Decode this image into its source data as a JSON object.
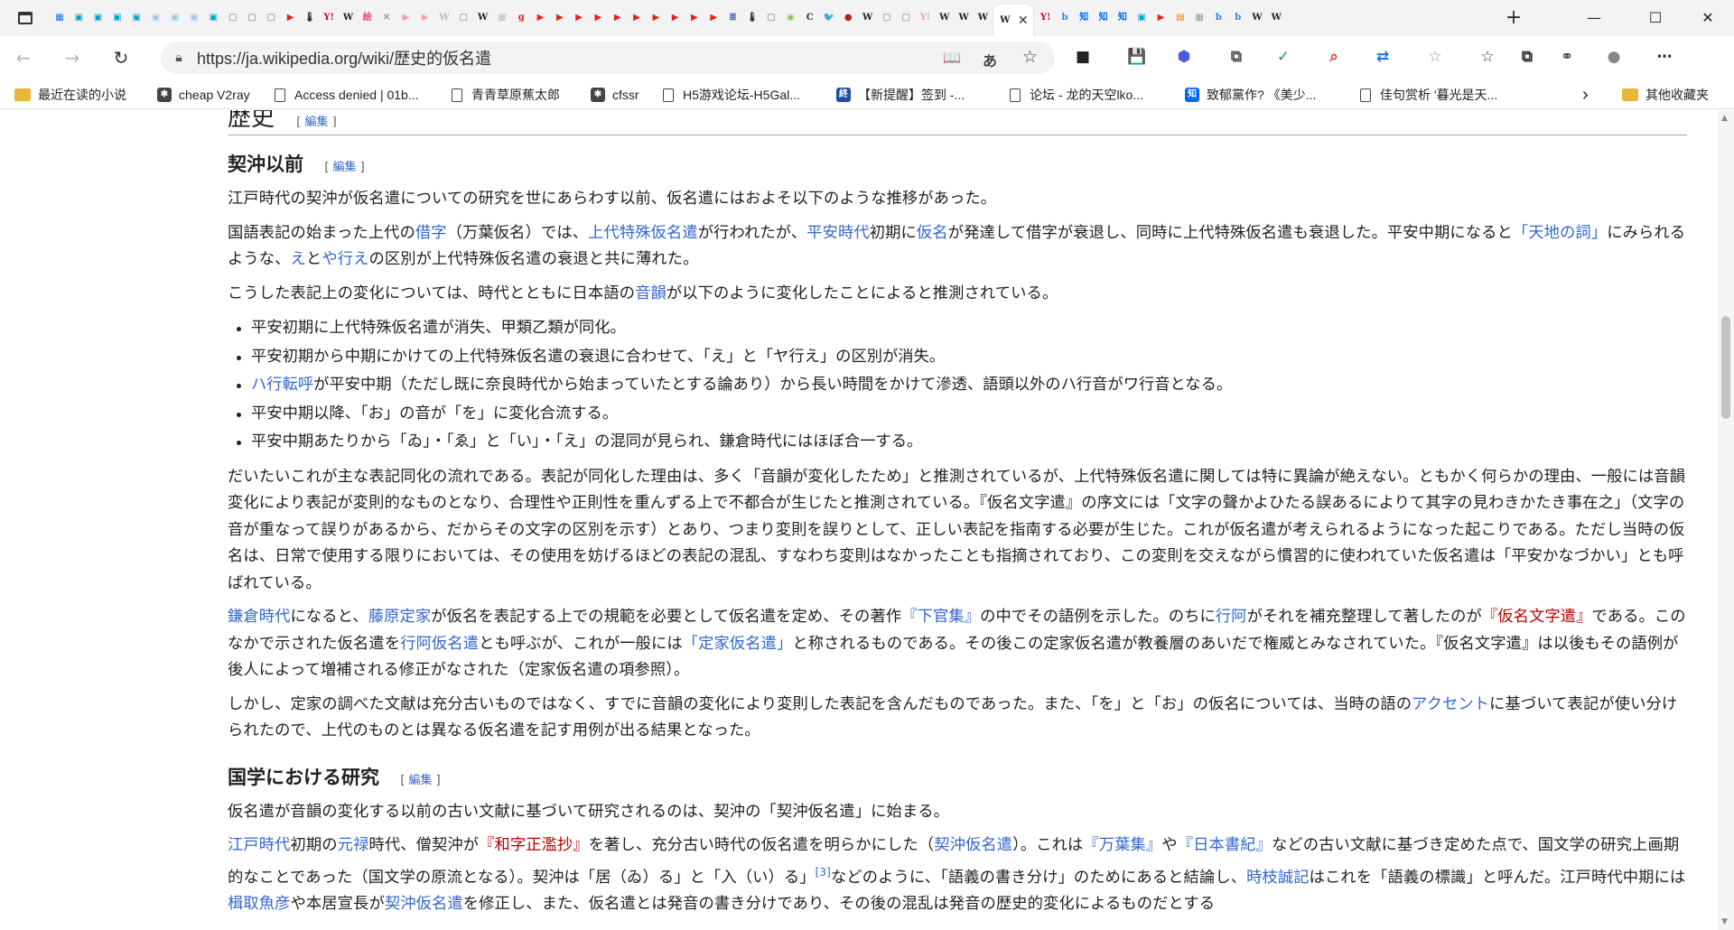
{
  "browser": {
    "tabs": [
      {
        "icon": "grid-icon",
        "color": "#1a73e8",
        "glyph": "▦"
      },
      {
        "icon": "bilibili-icon",
        "color": "#00a1d6",
        "glyph": "▣"
      },
      {
        "icon": "bilibili-icon",
        "color": "#00a1d6",
        "glyph": "▣"
      },
      {
        "icon": "bilibili-icon",
        "color": "#00a1d6",
        "glyph": "▣"
      },
      {
        "icon": "bilibili-icon",
        "color": "#00a1d6",
        "glyph": "▣"
      },
      {
        "icon": "bilibili-icon",
        "color": "#9ec9e0",
        "glyph": "▣"
      },
      {
        "icon": "bilibili-icon",
        "color": "#9ec9e0",
        "glyph": "▣"
      },
      {
        "icon": "bilibili-icon",
        "color": "#9ec9e0",
        "glyph": "▣"
      },
      {
        "icon": "bilibili-icon",
        "color": "#00a1d6",
        "glyph": "▣"
      },
      {
        "icon": "page-icon",
        "color": "#777",
        "glyph": "▢"
      },
      {
        "icon": "page-icon",
        "color": "#777",
        "glyph": "▢"
      },
      {
        "icon": "page-icon",
        "color": "#777",
        "glyph": "▢"
      },
      {
        "icon": "youtube-icon",
        "color": "#e62117",
        "glyph": "▶"
      },
      {
        "icon": "thermometer-icon",
        "color": "#222",
        "glyph": "🌡"
      },
      {
        "icon": "yahoo-icon",
        "color": "#d0021b",
        "glyph": "Y!"
      },
      {
        "icon": "wikipedia-icon",
        "color": "#222",
        "glyph": "W"
      },
      {
        "icon": "red-badge-icon",
        "color": "#e8478b",
        "glyph": "絵"
      },
      {
        "icon": "ghost-icon",
        "color": "#999",
        "glyph": "✕"
      },
      {
        "icon": "youtube-icon",
        "color": "#f0a0a0",
        "glyph": "▶"
      },
      {
        "icon": "youtube-icon",
        "color": "#f0a0a0",
        "glyph": "▶"
      },
      {
        "icon": "wikipedia-icon",
        "color": "#bbb",
        "glyph": "W"
      },
      {
        "icon": "page-icon",
        "color": "#777",
        "glyph": "▢"
      },
      {
        "icon": "wikipedia-icon",
        "color": "#222",
        "glyph": "W"
      },
      {
        "icon": "grid-icon",
        "color": "#bbb",
        "glyph": "▦"
      },
      {
        "icon": "google-icon",
        "color": "#e62117",
        "glyph": "g"
      },
      {
        "icon": "youtube-icon",
        "color": "#e62117",
        "glyph": "▶"
      },
      {
        "icon": "youtube-icon",
        "color": "#e62117",
        "glyph": "▶"
      },
      {
        "icon": "youtube-icon",
        "color": "#e62117",
        "glyph": "▶"
      },
      {
        "icon": "youtube-icon",
        "color": "#e62117",
        "glyph": "▶"
      },
      {
        "icon": "youtube-icon",
        "color": "#e62117",
        "glyph": "▶"
      },
      {
        "icon": "youtube-icon",
        "color": "#e62117",
        "glyph": "▶"
      },
      {
        "icon": "youtube-icon",
        "color": "#e62117",
        "glyph": "▶"
      },
      {
        "icon": "youtube-icon",
        "color": "#e62117",
        "glyph": "▶"
      },
      {
        "icon": "youtube-icon",
        "color": "#e62117",
        "glyph": "▶"
      },
      {
        "icon": "youtube-icon",
        "color": "#e62117",
        "glyph": "▶"
      },
      {
        "icon": "news-icon",
        "color": "#4a6fb5",
        "glyph": "≣"
      },
      {
        "icon": "thermometer-icon",
        "color": "#222",
        "glyph": "🌡"
      },
      {
        "icon": "page-icon",
        "color": "#777",
        "glyph": "▢"
      },
      {
        "icon": "android-icon",
        "color": "#8bc34a",
        "glyph": "◉"
      },
      {
        "icon": "c-icon",
        "color": "#333",
        "glyph": "C"
      },
      {
        "icon": "twitter-icon",
        "color": "#1da1f2",
        "glyph": "🐦"
      },
      {
        "icon": "anime-icon",
        "color": "#b02020",
        "glyph": "●"
      },
      {
        "icon": "wikipedia-icon",
        "color": "#222",
        "glyph": "W"
      },
      {
        "icon": "page-icon",
        "color": "#777",
        "glyph": "▢"
      },
      {
        "icon": "page-icon",
        "color": "#777",
        "glyph": "▢"
      },
      {
        "icon": "yahoo-icon",
        "color": "#f0a0c0",
        "glyph": "Y!"
      },
      {
        "icon": "wikipedia-icon",
        "color": "#222",
        "glyph": "W"
      },
      {
        "icon": "wikipedia-icon",
        "color": "#222",
        "glyph": "W"
      },
      {
        "icon": "wikipedia-icon",
        "color": "#222",
        "glyph": "W"
      },
      {
        "icon": "wikipedia-icon",
        "color": "#222",
        "glyph": "W",
        "active": true
      },
      {
        "icon": "yahoo-icon",
        "color": "#d0021b",
        "glyph": "Y!"
      },
      {
        "icon": "bing-icon",
        "color": "#2f80ed",
        "glyph": "b"
      },
      {
        "icon": "zhihu-icon",
        "color": "#0066ff",
        "glyph": "知"
      },
      {
        "icon": "zhihu-icon",
        "color": "#0066ff",
        "glyph": "知"
      },
      {
        "icon": "zhihu-icon",
        "color": "#0066ff",
        "glyph": "知"
      },
      {
        "icon": "bilibili-icon",
        "color": "#00a1d6",
        "glyph": "▣"
      },
      {
        "icon": "youtube-icon",
        "color": "#e62117",
        "glyph": "▶"
      },
      {
        "icon": "orange-icon",
        "color": "#f57c00",
        "glyph": "▤"
      },
      {
        "icon": "grid-icon",
        "color": "#999",
        "glyph": "▦"
      },
      {
        "icon": "bing-icon",
        "color": "#2f80ed",
        "glyph": "b"
      },
      {
        "icon": "bing-icon",
        "color": "#2f80ed",
        "glyph": "b"
      },
      {
        "icon": "wikipedia-icon",
        "color": "#222",
        "glyph": "W"
      },
      {
        "icon": "wikipedia-icon",
        "color": "#222",
        "glyph": "W"
      }
    ],
    "close_glyph": "✕",
    "newtab_glyph": "+",
    "window": {
      "minimize": "—",
      "maximize": "☐",
      "close": "✕"
    },
    "nav": {
      "back": "←",
      "forward": "→",
      "reload": "↻"
    },
    "url": "https://ja.wikipedia.org/wiki/歴史的仮名遣",
    "omni_icons": {
      "reader": "📖",
      "translate": "あ",
      "favorite": "☆"
    },
    "ext_icons": [
      {
        "name": "extension-dark-icon",
        "color": "#222",
        "glyph": "■"
      },
      {
        "name": "save-icon",
        "color": "#1aa0e8",
        "glyph": "💾"
      },
      {
        "name": "cube-icon",
        "color": "#4e5bd8",
        "glyph": "⬢"
      },
      {
        "name": "puzzle-icon",
        "color": "#555",
        "glyph": "⧉"
      },
      {
        "name": "shield-icon",
        "color": "#1e9e4a",
        "glyph": "✓"
      },
      {
        "name": "search-red-icon",
        "color": "#e53935",
        "glyph": "⌕"
      },
      {
        "name": "translate-icon",
        "color": "#1a73e8",
        "glyph": "⇄"
      },
      {
        "name": "favorites-icon",
        "color": "#999",
        "glyph": "☆"
      },
      {
        "name": "favorites-list-icon",
        "color": "#333",
        "glyph": "☆"
      },
      {
        "name": "collections-icon",
        "color": "#333",
        "glyph": "⧉"
      },
      {
        "name": "link-icon",
        "color": "#333",
        "glyph": "⚭"
      },
      {
        "name": "profile-icon",
        "color": "#888",
        "glyph": "●"
      },
      {
        "name": "more-icon",
        "color": "#333",
        "glyph": "⋯"
      }
    ]
  },
  "bookmarks": [
    {
      "type": "folder",
      "label": "最近在读的小说"
    },
    {
      "type": "site",
      "label": "cheap V2ray",
      "icon": "spider-icon",
      "color": "#444",
      "glyph": "✱"
    },
    {
      "type": "page",
      "label": "Access denied | 01b..."
    },
    {
      "type": "page",
      "label": "青青草原蕉太郎"
    },
    {
      "type": "site",
      "label": "cfssr",
      "icon": "spider-icon",
      "color": "#444",
      "glyph": "✱"
    },
    {
      "type": "page",
      "label": "H5游戏论坛-H5Gal..."
    },
    {
      "type": "site",
      "label": "【新提醒】签到 -...",
      "icon": "blue-kanji-icon",
      "color": "#1e4fa3",
      "glyph": "終"
    },
    {
      "type": "page",
      "label": "论坛 - 龙的天空lko..."
    },
    {
      "type": "site",
      "label": "致郁黨作? 《美少...",
      "icon": "zhihu-icon",
      "color": "#0066ff",
      "glyph": "知"
    },
    {
      "type": "page",
      "label": "佳句赏析 '暮光是天..."
    },
    {
      "type": "chevron",
      "label": "›"
    },
    {
      "type": "folder",
      "label": "其他收藏夹"
    }
  ],
  "article": {
    "section_title": "歴史",
    "edit_label": "編集",
    "sub1_title": "契沖以前",
    "p1": "江戸時代の契沖が仮名遣についての研究を世にあらわす以前、仮名遣にはおよそ以下のような推移があった。",
    "p2": [
      {
        "t": "国語表記の始まった上代の"
      },
      {
        "t": "借字",
        "l": true
      },
      {
        "t": "（万葉仮名）では、"
      },
      {
        "t": "上代特殊仮名遣",
        "l": true
      },
      {
        "t": "が行われたが、"
      },
      {
        "t": "平安時代",
        "l": true
      },
      {
        "t": "初期に"
      },
      {
        "t": "仮名",
        "l": true
      },
      {
        "t": "が発達して借字が衰退し、同時に上代特殊仮名遣も衰退した。平安中期になると"
      },
      {
        "t": "「天地の詞」",
        "l": true
      },
      {
        "t": "にみられるような、"
      },
      {
        "t": "え",
        "l": true
      },
      {
        "t": "と"
      },
      {
        "t": "や行え",
        "l": true
      },
      {
        "t": "の区別が上代特殊仮名遣の衰退と共に薄れた。"
      }
    ],
    "p3": [
      {
        "t": "こうした表記上の変化については、時代とともに日本語の"
      },
      {
        "t": "音韻",
        "l": true
      },
      {
        "t": "が以下のように変化したことによると推測されている。"
      }
    ],
    "bullets": [
      [
        {
          "t": "平安初期に上代特殊仮名遣が消失、甲類乙類が同化。"
        }
      ],
      [
        {
          "t": "平安初期から中期にかけての上代特殊仮名遣の衰退に合わせて、「え」と「ヤ行え」の区別が消失。"
        }
      ],
      [
        {
          "t": "ハ行転呼",
          "l": true
        },
        {
          "t": "が平安中期（ただし既に奈良時代から始まっていたとする論あり）から長い時間をかけて滲透、語頭以外のハ行音がワ行音となる。"
        }
      ],
      [
        {
          "t": "平安中期以降、「お」の音が「を」に変化合流する。"
        }
      ],
      [
        {
          "t": "平安中期あたりから「ゐ」・「ゑ」と「い」・「え」の混同が見られ、鎌倉時代にはほぼ合一する。"
        }
      ]
    ],
    "p4": "だいたいこれが主な表記同化の流れである。表記が同化した理由は、多く「音韻が変化したため」と推測されているが、上代特殊仮名遣に関しては特に異論が絶えない。ともかく何らかの理由、一般には音韻変化により表記が変則的なものとなり、合理性や正則性を重んずる上で不都合が生じたと推測されている。『仮名文字遣』の序文には「文字の聲かよひたる誤あるによりて其字の見わきかたき事在之」（文字の音が重なって誤りがあるから、だからその文字の区別を示す）とあり、つまり変則を誤りとして、正しい表記を指南する必要が生じた。これが仮名遣が考えられるようになった起こりである。ただし当時の仮名は、日常で使用する限りにおいては、その使用を妨げるほどの表記の混乱、すなわち変則はなかったことも指摘されており、この変則を交えながら慣習的に使われていた仮名遣は「平安かなづかい」とも呼ばれている。",
    "p5": [
      {
        "t": "鎌倉時代",
        "l": true
      },
      {
        "t": "になると、"
      },
      {
        "t": "藤原定家",
        "l": true
      },
      {
        "t": "が仮名を表記する上での規範を必要として仮名遣を定め、その著作"
      },
      {
        "t": "『下官集』",
        "l": true
      },
      {
        "t": "の中でその語例を示した。のちに"
      },
      {
        "t": "行阿",
        "l": true
      },
      {
        "t": "がそれを補充整理して著したのが"
      },
      {
        "t": "『仮名文字遣』",
        "r": true
      },
      {
        "t": "である。このなかで示された仮名遣を"
      },
      {
        "t": "行阿仮名遣",
        "l": true
      },
      {
        "t": "とも呼ぶが、これが一般には"
      },
      {
        "t": "「定家仮名遣」",
        "l": true
      },
      {
        "t": "と称されるものである。その後この定家仮名遣が教養層のあいだで権威とみなされていた。『仮名文字遣』は以後もその語例が後人によって増補される修正がなされた（定家仮名遣の項参照）。"
      }
    ],
    "p6": [
      {
        "t": "しかし、定家の調べた文献は充分古いものではなく、すでに音韻の変化により変則した表記を含んだものであった。また、「を」と「お」の仮名については、当時の語の"
      },
      {
        "t": "アクセント",
        "l": true
      },
      {
        "t": "に基づいて表記が使い分けられたので、上代のものとは異なる仮名遣を記す用例が出る結果となった。"
      }
    ],
    "sub2_title": "国学における研究",
    "p7": "仮名遣が音韻の変化する以前の古い文献に基づいて研究されるのは、契沖の「契沖仮名遣」に始まる。",
    "p8": [
      {
        "t": "江戸時代",
        "l": true
      },
      {
        "t": "初期の"
      },
      {
        "t": "元禄",
        "l": true
      },
      {
        "t": "時代、僧契沖が"
      },
      {
        "t": "『和字正濫抄』",
        "r": true
      },
      {
        "t": "を著し、充分古い時代の仮名遣を明らかにした（"
      },
      {
        "t": "契沖仮名遣",
        "l": true
      },
      {
        "t": "）。これは"
      },
      {
        "t": "『万葉集』",
        "l": true
      },
      {
        "t": "や"
      },
      {
        "t": "『日本書紀』",
        "l": true
      },
      {
        "t": "などの古い文献に基づき定めた点で、国文学の研究上画期的なことであった（国文学の原流となる）。契沖は「居（ゐ）る」と「入（い）る」"
      },
      {
        "t": "[3]",
        "s": true
      },
      {
        "t": "などのように、「語義の書き分け」のためにあると結論し、"
      },
      {
        "t": "時枝誠記",
        "l": true
      },
      {
        "t": "はこれを「語義の標識」と呼んだ。江戸時代中期には"
      },
      {
        "t": "楫取魚彦",
        "l": true
      },
      {
        "t": "や本居宣長が"
      },
      {
        "t": "契沖仮名遣",
        "l": true
      },
      {
        "t": "を修正し、また、仮名遣とは発音の書き分けであり、その後の混乱は発音の歴史的変化によるものだとする"
      }
    ]
  }
}
